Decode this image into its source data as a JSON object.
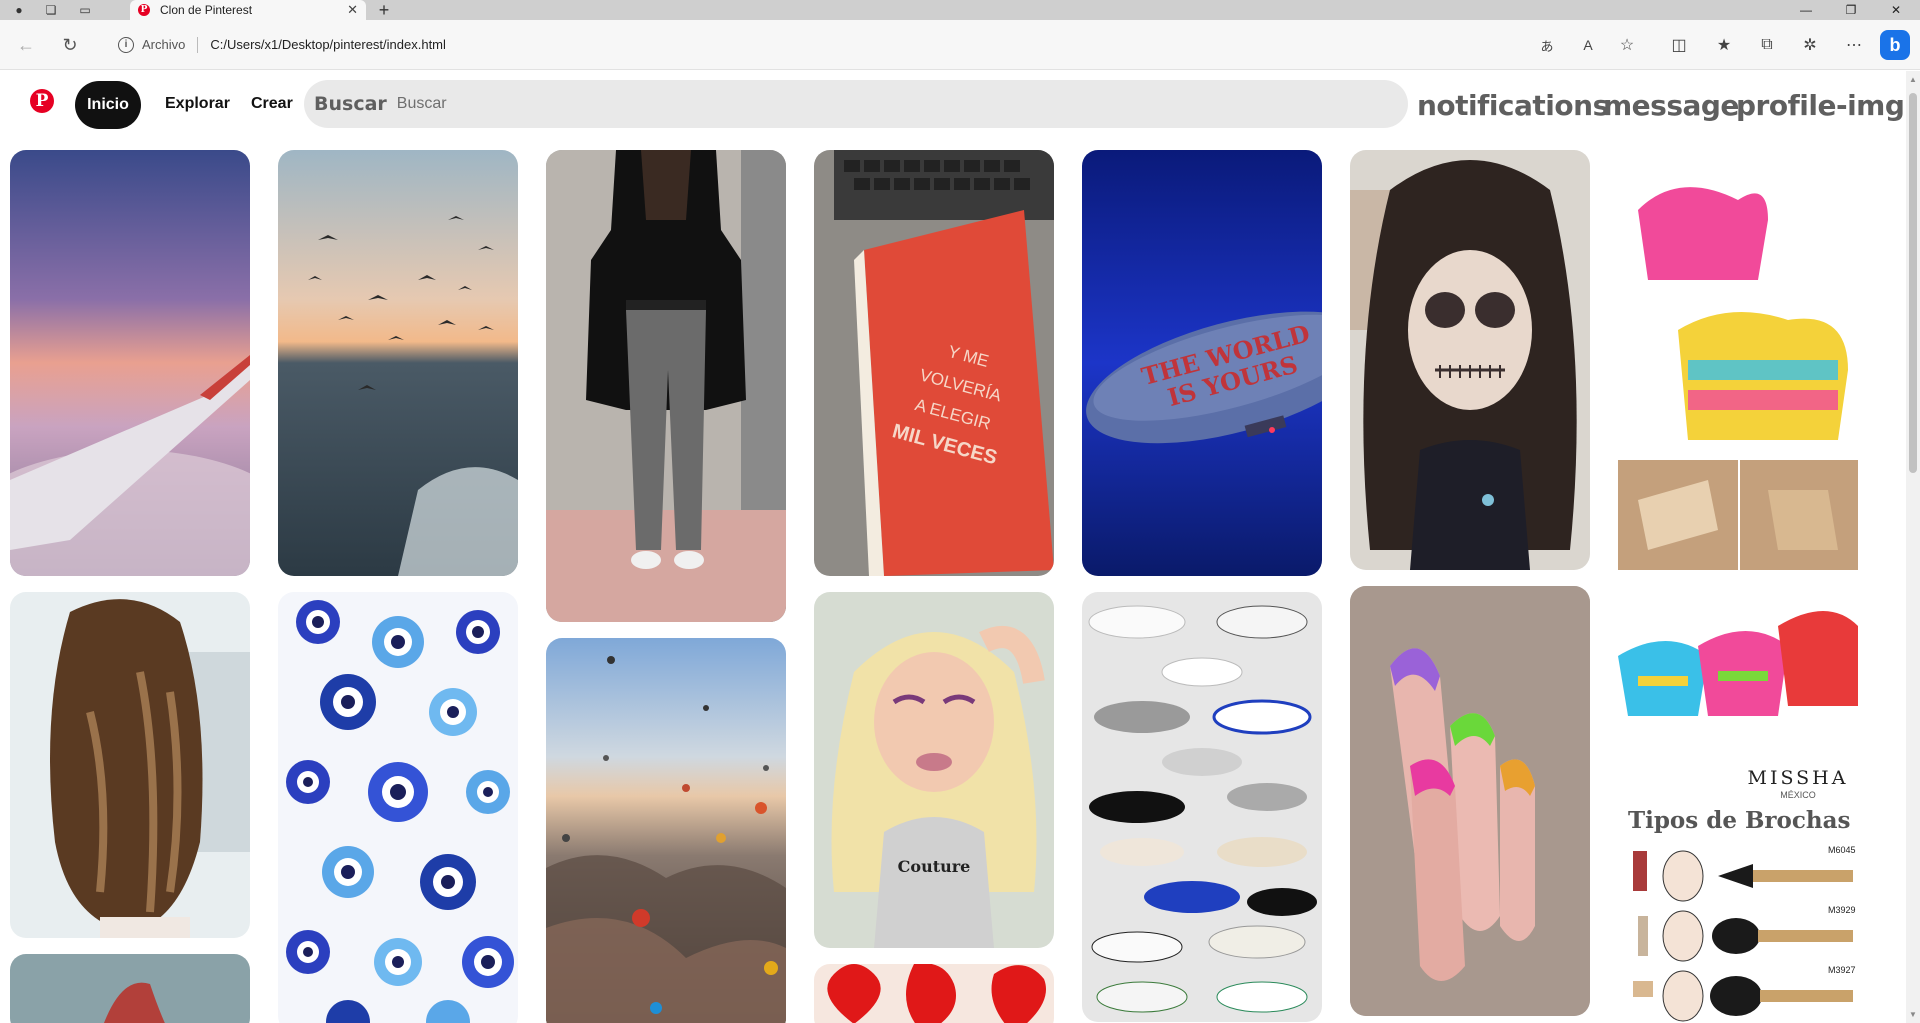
{
  "browser": {
    "tab_title": "Clon de Pinterest",
    "tab_close": "✕",
    "new_tab": "+",
    "address_scheme": "Archivo",
    "address_url": "C:/Users/x1/Desktop/pinterest/index.html",
    "window_controls": [
      "—",
      "❐",
      "✕"
    ]
  },
  "header": {
    "logo": "P",
    "home_label": "Inicio",
    "explore_label": "Explorar",
    "create_label": "Crear",
    "search_label": "Buscar",
    "search_placeholder": "Buscar",
    "notifications_label": "notifications",
    "message_label": "message",
    "profile_label": "profile-img"
  },
  "pins": [
    {
      "desc": "sunset-airplane-wing"
    },
    {
      "desc": "long-wavy-hair"
    },
    {
      "desc": "partial-landscape"
    },
    {
      "desc": "seagulls-over-sea"
    },
    {
      "desc": "evil-eye-pattern"
    },
    {
      "desc": "black-blazer-outfit"
    },
    {
      "desc": "hot-air-balloons"
    },
    {
      "desc": "red-book-on-laptop",
      "text": [
        "Y ME",
        "VOLVERÍA",
        "A ELEGIR",
        "MIL VECES"
      ]
    },
    {
      "desc": "bratz-doll",
      "text": [
        "Couture"
      ]
    },
    {
      "desc": "red-hearts"
    },
    {
      "desc": "blimp-night-sky",
      "text": [
        "THE WORLD",
        "IS YOURS"
      ]
    },
    {
      "desc": "sneakers-collage"
    },
    {
      "desc": "skull-makeup-portrait"
    },
    {
      "desc": "french-nails"
    },
    {
      "desc": "mini-pinatas"
    },
    {
      "desc": "makeup-brushes-ad",
      "text": [
        "MISSHA",
        "MÉXICO",
        "Tipos de Brochas",
        "M6045",
        "M3929",
        "M3927"
      ]
    }
  ]
}
